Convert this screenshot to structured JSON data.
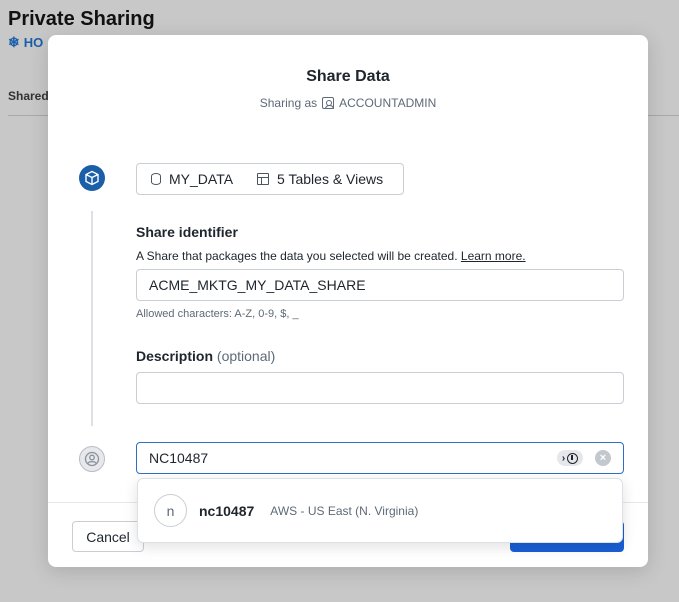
{
  "background": {
    "title": "Private Sharing",
    "brand": "HO",
    "tab": "Shared"
  },
  "modal": {
    "title": "Share Data",
    "sharing_as_prefix": "Sharing as",
    "sharing_as_user": "ACCOUNTADMIN",
    "data_pill": {
      "database": "MY_DATA",
      "objects": "5 Tables & Views"
    },
    "share_identifier": {
      "label": "Share identifier",
      "helper": "A Share that packages the data you selected will be created.",
      "learn_more": "Learn more.",
      "value": "ACME_MKTG_MY_DATA_SHARE",
      "hint": "Allowed characters: A-Z, 0-9, $, _"
    },
    "description": {
      "label": "Description",
      "optional": "(optional)",
      "value": ""
    },
    "consumer_search": {
      "value": "NC10487"
    },
    "dropdown": {
      "avatar_letter": "n",
      "account_name": "nc10487",
      "region": "AWS - US East (N. Virginia)"
    },
    "footer": {
      "cancel_label": "Cancel"
    }
  },
  "colors": {
    "accent": "#1a5fd6",
    "step_active": "#1a5fa8"
  }
}
